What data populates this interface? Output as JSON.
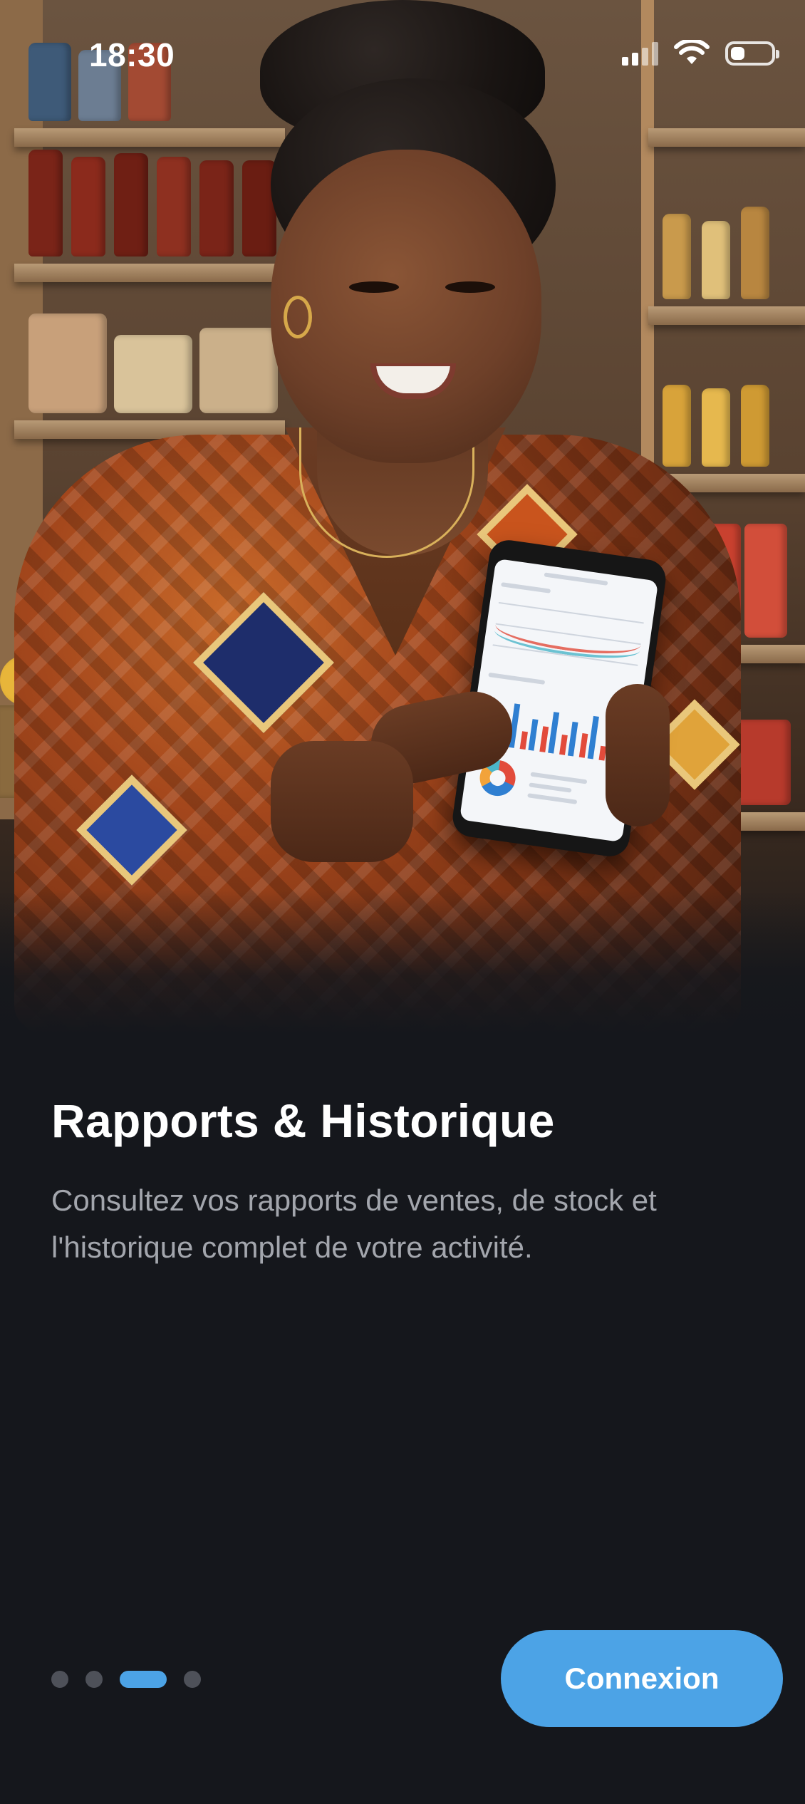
{
  "status_bar": {
    "time": "18:30",
    "icons": [
      "cellular-signal-icon",
      "wifi-icon",
      "battery-icon"
    ],
    "battery_level": 0.35
  },
  "hero": {
    "image": "hero-photo"
  },
  "onboarding": {
    "title": "Rapports & Historique",
    "description": "Consultez vos rapports de ventes, de stock et l'historique complet de votre activité."
  },
  "pagination": {
    "total": 4,
    "current": 3
  },
  "actions": {
    "login_label": "Connexion"
  },
  "colors": {
    "background": "#15171c",
    "accent": "#4ca3e6",
    "title": "#ffffff",
    "description": "#a3a6ad",
    "dot_inactive": "#4e5159"
  }
}
